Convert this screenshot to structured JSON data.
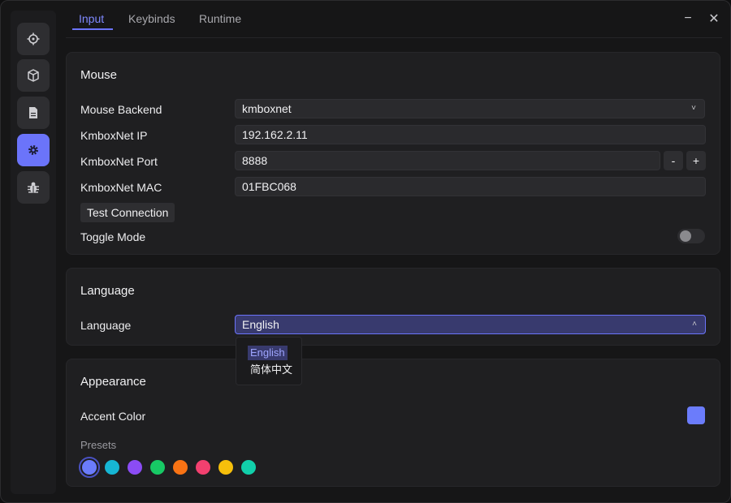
{
  "sidebar": {
    "items": [
      {
        "name": "crosshair-icon",
        "active": false
      },
      {
        "name": "cube-icon",
        "active": false
      },
      {
        "name": "file-icon",
        "active": false
      },
      {
        "name": "gear-icon",
        "active": true
      },
      {
        "name": "bug-icon",
        "active": false
      }
    ]
  },
  "tabs": {
    "items": [
      {
        "label": "Input"
      },
      {
        "label": "Keybinds"
      },
      {
        "label": "Runtime"
      }
    ],
    "active": "Input"
  },
  "window": {
    "minimize_glyph": "−",
    "close_glyph": "✕"
  },
  "mouse": {
    "title": "Mouse",
    "backend_label": "Mouse Backend",
    "backend_value": "kmboxnet",
    "ip_label": "KmboxNet IP",
    "ip_value": "192.162.2.11",
    "port_label": "KmboxNet Port",
    "port_value": "8888",
    "port_decrement": "-",
    "port_increment": "+",
    "mac_label": "KmboxNet MAC",
    "mac_value": "01FBC068",
    "test_button": "Test Connection",
    "toggle_label": "Toggle Mode",
    "toggle_on": false
  },
  "language": {
    "title": "Language",
    "label": "Language",
    "value": "English",
    "options": [
      "English",
      "简体中文"
    ],
    "selected": "English"
  },
  "appearance": {
    "title": "Appearance",
    "accent_label": "Accent Color",
    "accent_color": "#6b7cfb",
    "presets_label": "Presets",
    "presets": [
      "#6b7cfb",
      "#16b6d4",
      "#8b4cf5",
      "#17c965",
      "#f97314",
      "#f2406f",
      "#f6bf0b",
      "#11cfaa"
    ],
    "selected_preset": 0
  },
  "colors": {
    "accent": "#6b74fa",
    "background": "#161617",
    "card": "#1f1f21"
  }
}
